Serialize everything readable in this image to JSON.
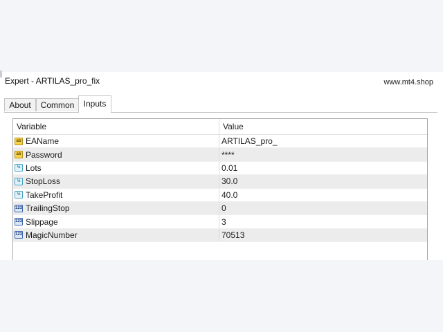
{
  "window": {
    "title": "Expert - ARTILAS_pro_fix",
    "watermark": "www.mt4.shop"
  },
  "tabs": [
    {
      "label": "About",
      "active": false
    },
    {
      "label": "Common",
      "active": false
    },
    {
      "label": "Inputs",
      "active": true
    }
  ],
  "grid": {
    "headers": {
      "variable": "Variable",
      "value": "Value"
    },
    "rows": [
      {
        "type_icon": "string-icon",
        "icon_text": "ab",
        "variable": "EAName",
        "value": "ARTILAS_pro_"
      },
      {
        "type_icon": "string-icon",
        "icon_text": "ab",
        "variable": "Password",
        "value": "****"
      },
      {
        "type_icon": "double-icon",
        "icon_text": "½",
        "variable": "Lots",
        "value": "0.01"
      },
      {
        "type_icon": "double-icon",
        "icon_text": "½",
        "variable": "StopLoss",
        "value": "30.0"
      },
      {
        "type_icon": "double-icon",
        "icon_text": "½",
        "variable": "TakeProfit",
        "value": "40.0"
      },
      {
        "type_icon": "int-icon",
        "icon_text": "123",
        "variable": "TrailingStop",
        "value": "0"
      },
      {
        "type_icon": "int-icon",
        "icon_text": "123",
        "variable": "Slippage",
        "value": "3"
      },
      {
        "type_icon": "int-icon",
        "icon_text": "123",
        "variable": "MagicNumber",
        "value": "70513"
      }
    ]
  },
  "colors": {
    "background": "#f4f5f8",
    "panel": "#ffffff",
    "row_alt": "#ececec",
    "string_icon": "#f6d24a",
    "double_icon": "#dff2f8",
    "int_icon": "#dbe6f6"
  }
}
